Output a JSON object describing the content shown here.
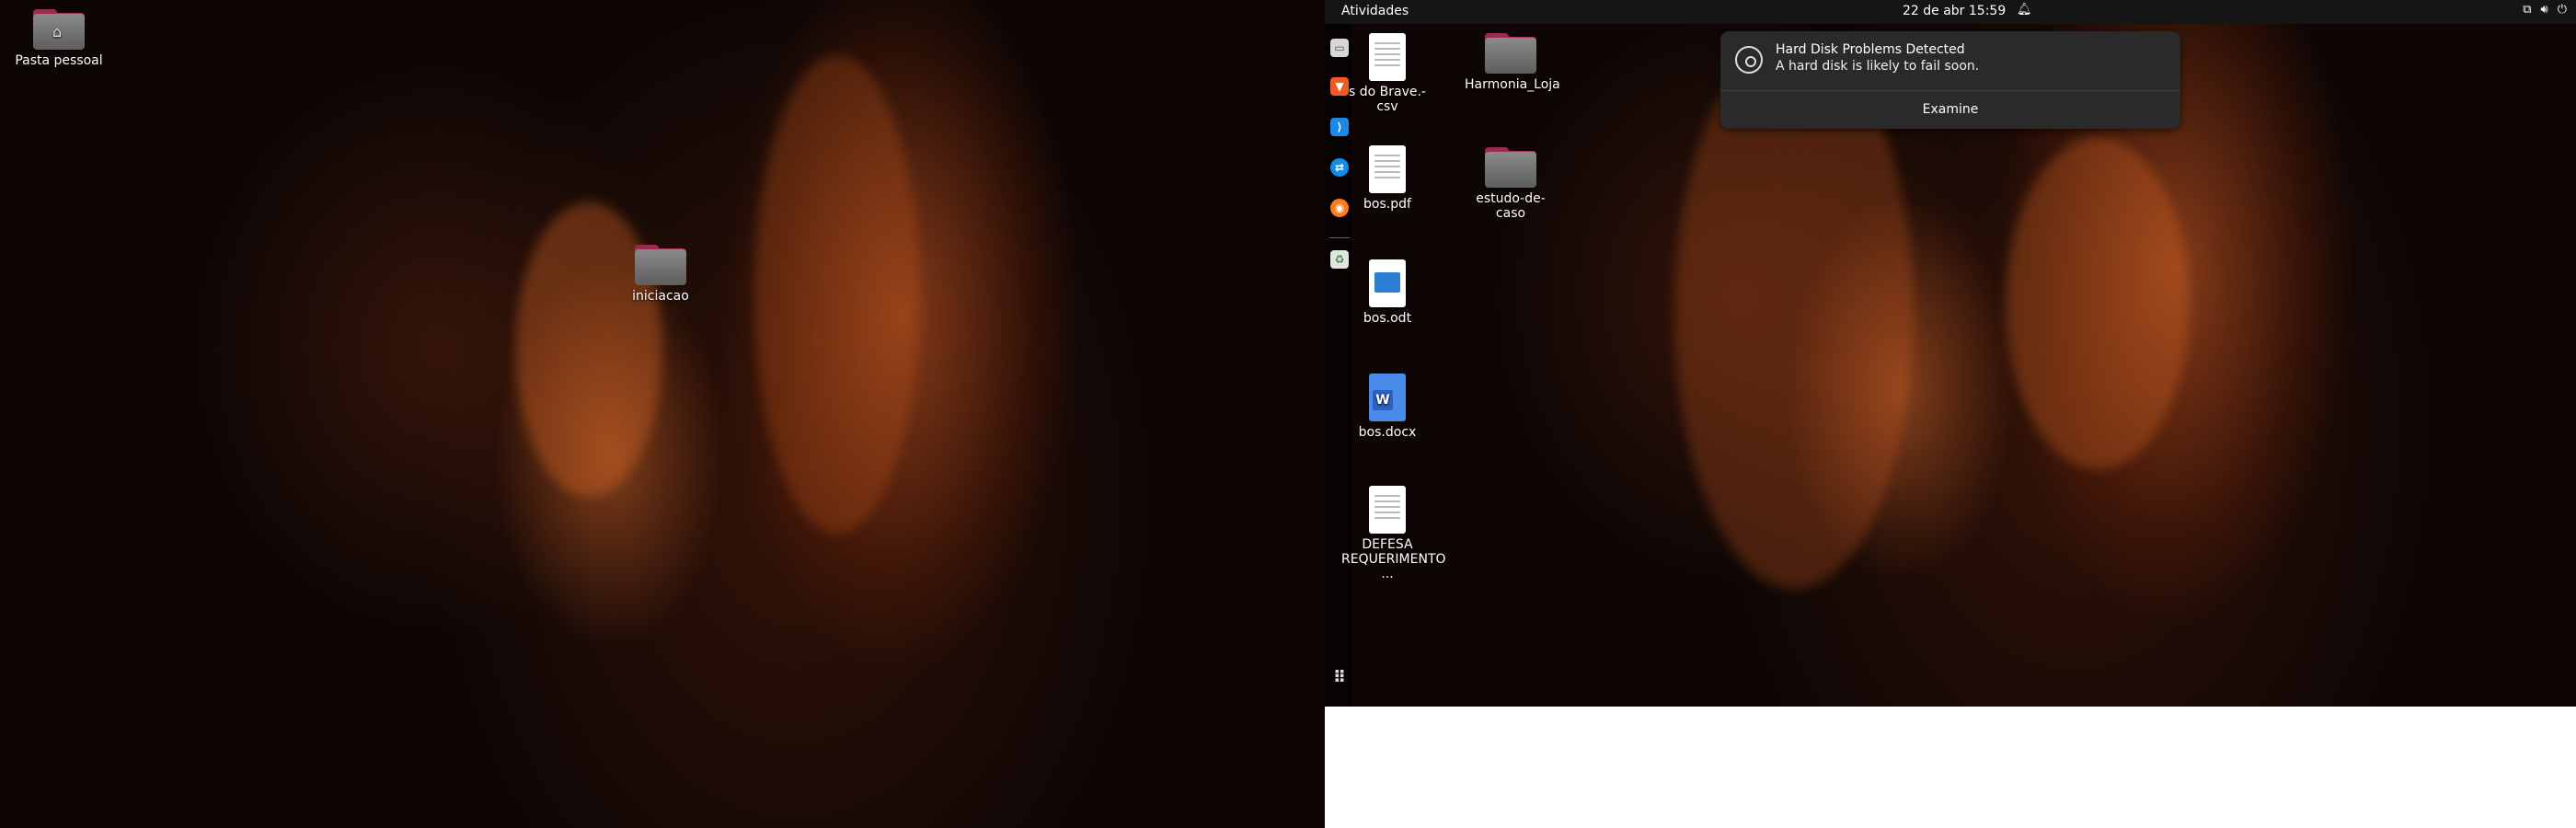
{
  "left_monitor": {
    "icons": [
      {
        "label": "Pasta pessoal",
        "kind": "home-folder"
      },
      {
        "label": "iniciacao",
        "kind": "folder"
      }
    ]
  },
  "right_monitor": {
    "topbar": {
      "activities": "Atividades",
      "clock": "22 de abr  15:59"
    },
    "dock": {
      "apps": [
        "files",
        "brave",
        "vscode",
        "teamviewer",
        "firefox",
        "trash",
        "show-apps"
      ]
    },
    "icons": [
      {
        "label": "s do Brave.-\ncsv",
        "kind": "document"
      },
      {
        "label": "bos.pdf",
        "kind": "pdf"
      },
      {
        "label": "bos.odt",
        "kind": "odt"
      },
      {
        "label": "bos.docx",
        "kind": "docx"
      },
      {
        "label": "DEFESA\nREQUERIMENTO ...",
        "kind": "document"
      },
      {
        "label": "Harmonia_Loja",
        "kind": "folder"
      },
      {
        "label": "estudo-de-caso",
        "kind": "folder"
      }
    ],
    "notification": {
      "title": "Hard Disk Problems Detected",
      "body": "A hard disk is likely to fail soon.",
      "action": "Examine"
    }
  },
  "colors": {
    "folder_tab": "#9b2a4f",
    "topbar": "#151515",
    "notification_bg": "#2a2a2a"
  }
}
